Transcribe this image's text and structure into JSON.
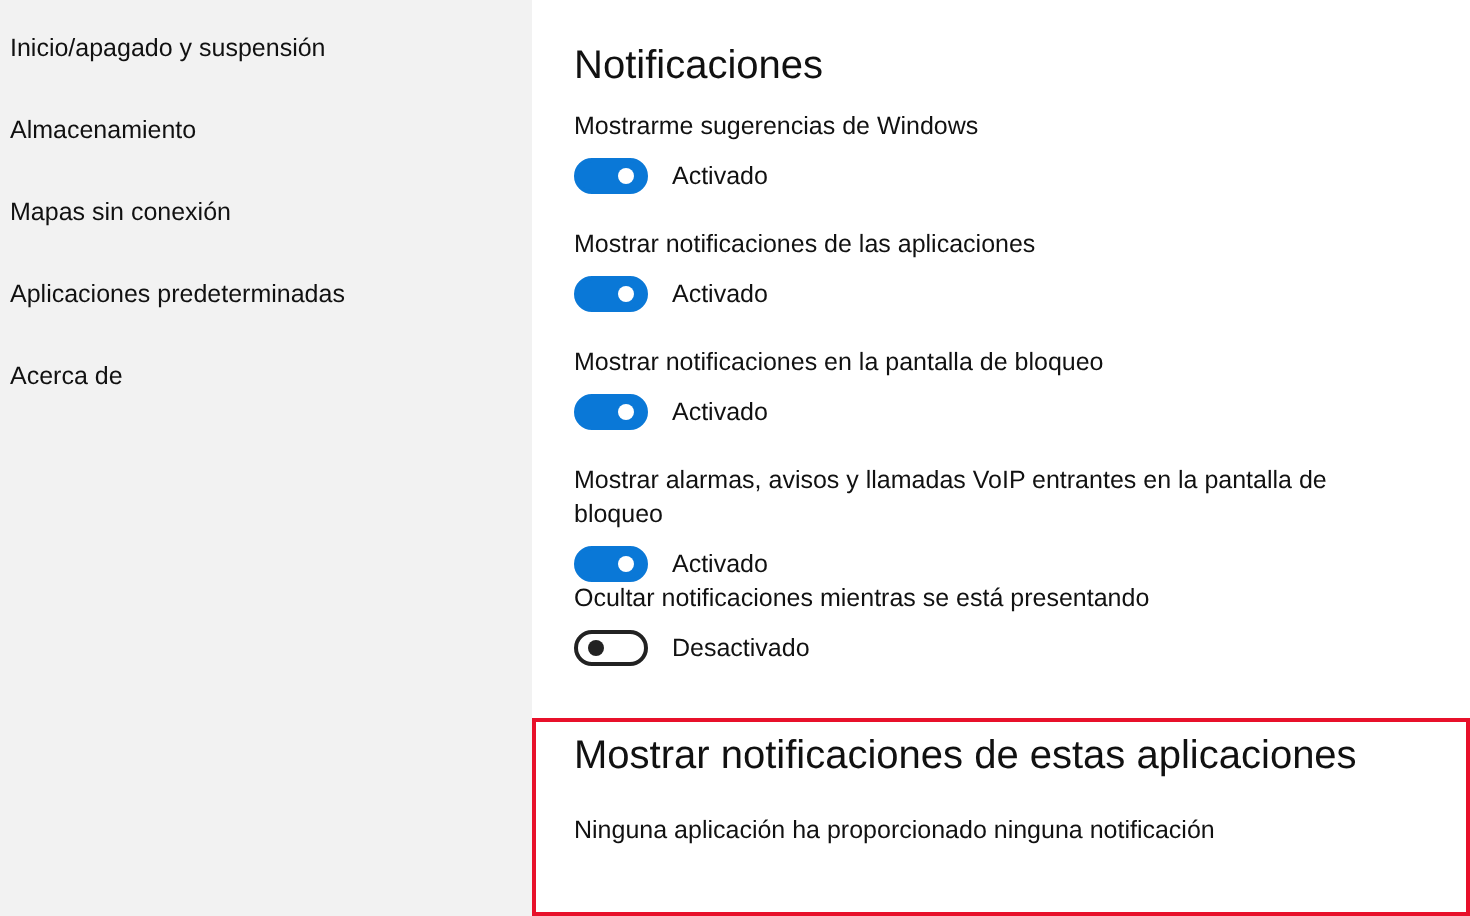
{
  "sidebar": {
    "items": [
      {
        "label": "Inicio/apagado y suspensión"
      },
      {
        "label": "Almacenamiento"
      },
      {
        "label": "Mapas sin conexión"
      },
      {
        "label": "Aplicaciones predeterminadas"
      },
      {
        "label": "Acerca de"
      }
    ]
  },
  "main": {
    "heading": "Notificaciones",
    "settings": [
      {
        "label": "Mostrarme sugerencias de Windows",
        "on": true,
        "state_text": "Activado"
      },
      {
        "label": "Mostrar notificaciones de las aplicaciones",
        "on": true,
        "state_text": "Activado"
      },
      {
        "label": "Mostrar notificaciones en la pantalla de bloqueo",
        "on": true,
        "state_text": "Activado"
      },
      {
        "label": "Mostrar alarmas, avisos y llamadas VoIP entrantes en la pantalla de bloqueo",
        "on": true,
        "state_text": "Activado"
      },
      {
        "label": "Ocultar notificaciones mientras se está presentando",
        "on": false,
        "state_text": "Desactivado"
      }
    ],
    "apps_section": {
      "heading": "Mostrar notificaciones de estas aplicaciones",
      "message": "Ninguna aplicación ha proporcionado ninguna notificación",
      "highlighted": true
    }
  }
}
